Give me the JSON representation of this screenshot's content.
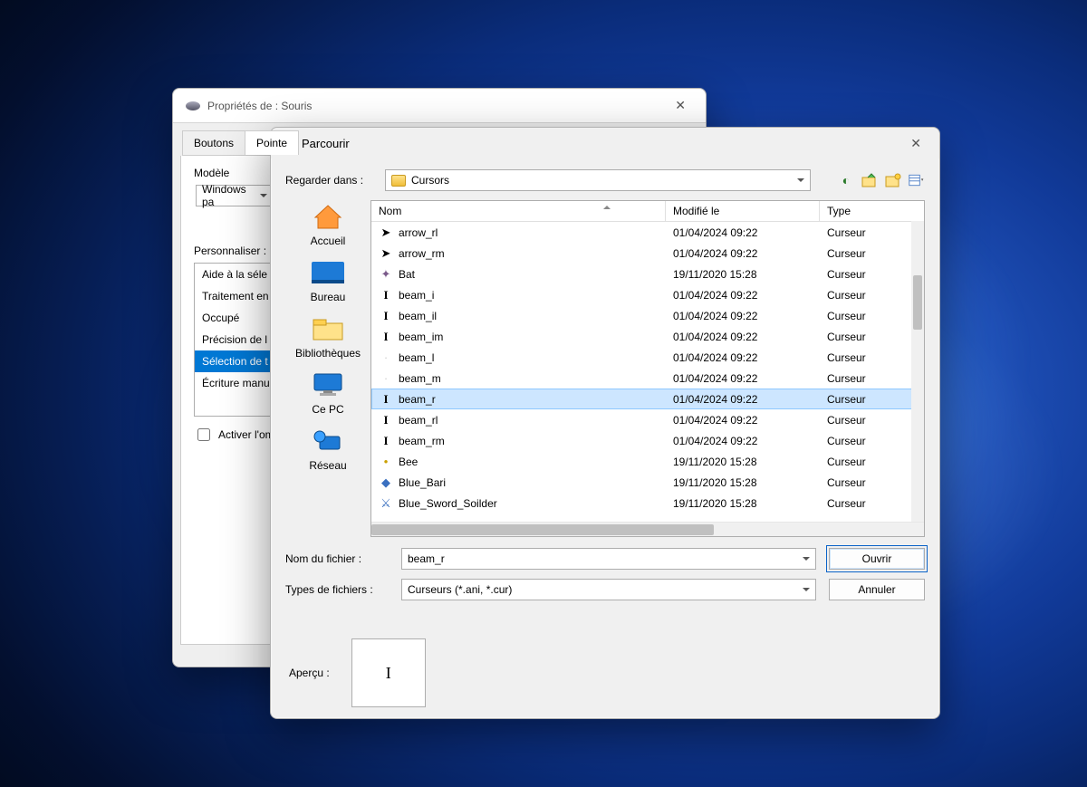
{
  "props_window": {
    "title": "Propriétés de : Souris",
    "tabs": [
      "Boutons",
      "Pointe"
    ],
    "active_tab_index": 1,
    "scheme_section_label": "Modèle",
    "scheme_value": "Windows pa",
    "custom_section_label": "Personnaliser :",
    "cursor_list": [
      "Aide à la séle",
      "Traitement en",
      "Occupé",
      "Précision de l",
      "Sélection de t",
      "Écriture manu"
    ],
    "selected_cursor_index": 4,
    "shadow_checkbox_label": "Activer l'om"
  },
  "browse_window": {
    "title": "Parcourir",
    "lookin_label": "Regarder dans :",
    "lookin_value": "Cursors",
    "places": [
      "Accueil",
      "Bureau",
      "Bibliothèques",
      "Ce PC",
      "Réseau"
    ],
    "columns": {
      "name": "Nom",
      "modified": "Modifié le",
      "type": "Type"
    },
    "files": [
      {
        "icon": "arrow",
        "name": "arrow_rl",
        "modified": "01/04/2024 09:22",
        "type": "Curseur"
      },
      {
        "icon": "arrow",
        "name": "arrow_rm",
        "modified": "01/04/2024 09:22",
        "type": "Curseur"
      },
      {
        "icon": "bat",
        "name": "Bat",
        "modified": "19/11/2020 15:28",
        "type": "Curseur"
      },
      {
        "icon": "ibeam",
        "name": "beam_i",
        "modified": "01/04/2024 09:22",
        "type": "Curseur"
      },
      {
        "icon": "ibeam",
        "name": "beam_il",
        "modified": "01/04/2024 09:22",
        "type": "Curseur"
      },
      {
        "icon": "ibeam",
        "name": "beam_im",
        "modified": "01/04/2024 09:22",
        "type": "Curseur"
      },
      {
        "icon": "blank",
        "name": "beam_l",
        "modified": "01/04/2024 09:22",
        "type": "Curseur"
      },
      {
        "icon": "blank",
        "name": "beam_m",
        "modified": "01/04/2024 09:22",
        "type": "Curseur"
      },
      {
        "icon": "ibeam",
        "name": "beam_r",
        "modified": "01/04/2024 09:22",
        "type": "Curseur"
      },
      {
        "icon": "ibeam",
        "name": "beam_rl",
        "modified": "01/04/2024 09:22",
        "type": "Curseur"
      },
      {
        "icon": "ibeam",
        "name": "beam_rm",
        "modified": "01/04/2024 09:22",
        "type": "Curseur"
      },
      {
        "icon": "bee",
        "name": "Bee",
        "modified": "19/11/2020 15:28",
        "type": "Curseur"
      },
      {
        "icon": "blue",
        "name": "Blue_Bari",
        "modified": "19/11/2020 15:28",
        "type": "Curseur"
      },
      {
        "icon": "sword",
        "name": "Blue_Sword_Soilder",
        "modified": "19/11/2020 15:28",
        "type": "Curseur"
      }
    ],
    "selected_file_index": 8,
    "filename_label": "Nom du fichier :",
    "filename_value": "beam_r",
    "filetype_label": "Types de fichiers :",
    "filetype_value": "Curseurs (*.ani, *.cur)",
    "open_button": "Ouvrir",
    "cancel_button": "Annuler",
    "preview_label": "Aperçu :",
    "preview_glyph": "I"
  }
}
